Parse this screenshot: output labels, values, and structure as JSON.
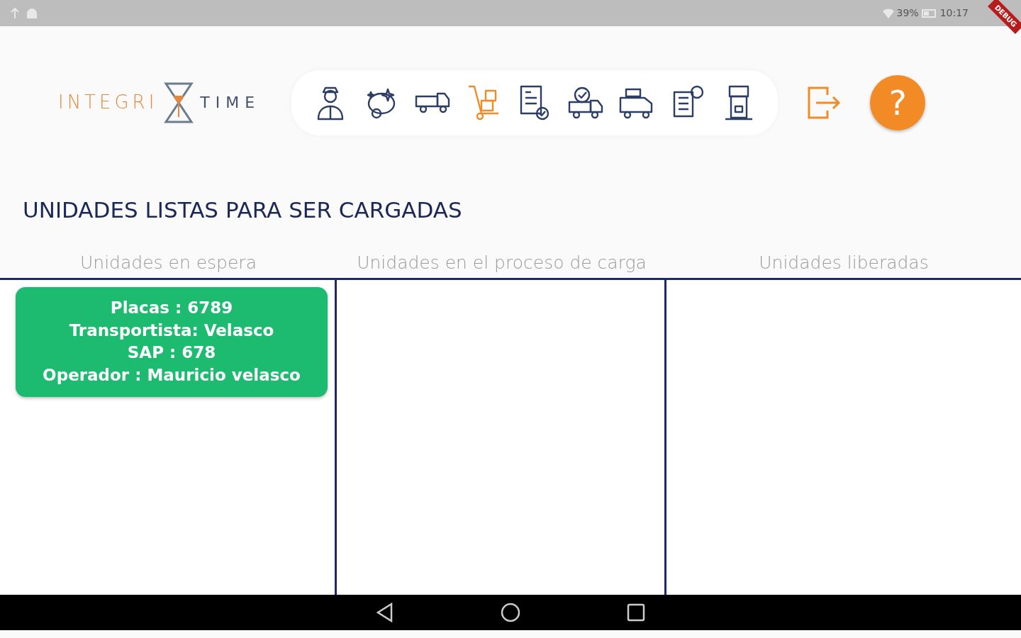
{
  "status_bar": {
    "battery": "39%",
    "time": "10:17"
  },
  "debug_banner": "DEBUG",
  "logo": {
    "left": "INTEGRI",
    "right": "TIME"
  },
  "nav_icons": [
    {
      "kind": "guard",
      "selected": false
    },
    {
      "kind": "cleaning",
      "selected": false
    },
    {
      "kind": "truck",
      "selected": false
    },
    {
      "kind": "handtruck",
      "selected": true
    },
    {
      "kind": "document",
      "selected": false
    },
    {
      "kind": "truckcheck",
      "selected": false
    },
    {
      "kind": "loadedtruck",
      "selected": false
    },
    {
      "kind": "invoice",
      "selected": false
    },
    {
      "kind": "kiosk",
      "selected": false
    }
  ],
  "help_button": "?",
  "page_title": "UNIDADES LISTAS PARA SER CARGADAS",
  "columns": [
    {
      "header": "Unidades en espera",
      "cards": [
        {
          "lines": [
            "Placas : 6789",
            "Transportista: Velasco",
            "SAP : 678",
            "Operador : Mauricio velasco"
          ]
        }
      ]
    },
    {
      "header": "Unidades en el proceso de carga"
    },
    {
      "header": "Unidades liberadas"
    }
  ]
}
